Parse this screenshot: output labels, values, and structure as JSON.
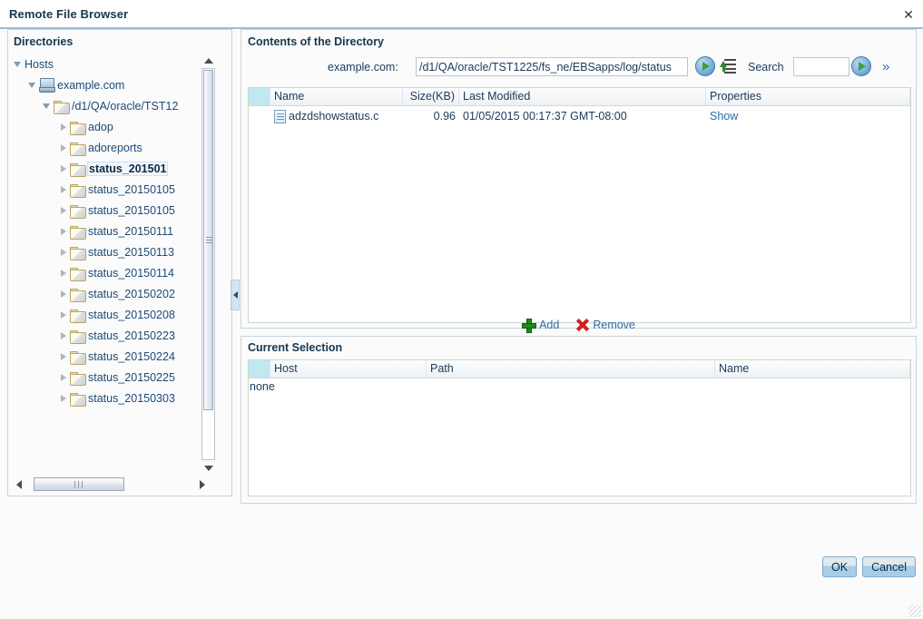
{
  "window": {
    "title": "Remote File Browser",
    "close_icon": "close-icon"
  },
  "directories": {
    "title": "Directories",
    "tree": [
      {
        "label": "Hosts",
        "icon": "none",
        "twisty": "open",
        "indent": 0,
        "selected": false
      },
      {
        "label": "example.com",
        "icon": "host",
        "twisty": "open",
        "indent": 16,
        "selected": false
      },
      {
        "label": "/d1/QA/oracle/TST12",
        "icon": "folder",
        "twisty": "open",
        "indent": 32,
        "selected": false
      },
      {
        "label": "adop",
        "icon": "folder",
        "twisty": "closed",
        "indent": 50,
        "selected": false
      },
      {
        "label": "adoreports",
        "icon": "folder",
        "twisty": "closed",
        "indent": 50,
        "selected": false
      },
      {
        "label": "status_201501",
        "icon": "folder",
        "twisty": "closed",
        "indent": 50,
        "selected": true
      },
      {
        "label": "status_20150105",
        "icon": "folder",
        "twisty": "closed",
        "indent": 50,
        "selected": false
      },
      {
        "label": "status_20150105",
        "icon": "folder",
        "twisty": "closed",
        "indent": 50,
        "selected": false
      },
      {
        "label": "status_20150111",
        "icon": "folder",
        "twisty": "closed",
        "indent": 50,
        "selected": false
      },
      {
        "label": "status_20150113",
        "icon": "folder",
        "twisty": "closed",
        "indent": 50,
        "selected": false
      },
      {
        "label": "status_20150114",
        "icon": "folder",
        "twisty": "closed",
        "indent": 50,
        "selected": false
      },
      {
        "label": "status_20150202",
        "icon": "folder",
        "twisty": "closed",
        "indent": 50,
        "selected": false
      },
      {
        "label": "status_20150208",
        "icon": "folder",
        "twisty": "closed",
        "indent": 50,
        "selected": false
      },
      {
        "label": "status_20150223",
        "icon": "folder",
        "twisty": "closed",
        "indent": 50,
        "selected": false
      },
      {
        "label": "status_20150224",
        "icon": "folder",
        "twisty": "closed",
        "indent": 50,
        "selected": false
      },
      {
        "label": "status_20150225",
        "icon": "folder",
        "twisty": "closed",
        "indent": 50,
        "selected": false
      },
      {
        "label": "status_20150303",
        "icon": "folder",
        "twisty": "closed",
        "indent": 50,
        "selected": false
      }
    ]
  },
  "contents": {
    "title": "Contents of the Directory",
    "host_label": "example.com:",
    "path_value": "/d1/QA/oracle/TST1225/fs_ne/EBSapps/log/status",
    "path_placeholder": "",
    "go_icon": "go-arrow-icon",
    "collapse_icon": "collapse-all-icon",
    "search_label": "Search",
    "search_value": "",
    "search_placeholder": "",
    "search_go_icon": "go-arrow-icon",
    "more_icon": "double-chevron-right-icon",
    "columns": [
      "",
      "Name",
      "Size(KB)",
      "Last Modified",
      "Properties"
    ],
    "rows": [
      {
        "name": "adzdshowstatus.c",
        "size": "0.96",
        "modified": "01/05/2015 00:17:37 GMT-08:00",
        "properties": "Show",
        "file_icon": "file-icon"
      }
    ]
  },
  "actions": {
    "add_label": "Add",
    "add_icon": "plus-icon",
    "remove_label": "Remove",
    "remove_icon": "red-x-icon"
  },
  "selection": {
    "title": "Current Selection",
    "columns": [
      "",
      "Host",
      "Path",
      "Name"
    ],
    "empty_text": "none"
  },
  "footer": {
    "ok_label": "OK",
    "cancel_label": "Cancel"
  }
}
